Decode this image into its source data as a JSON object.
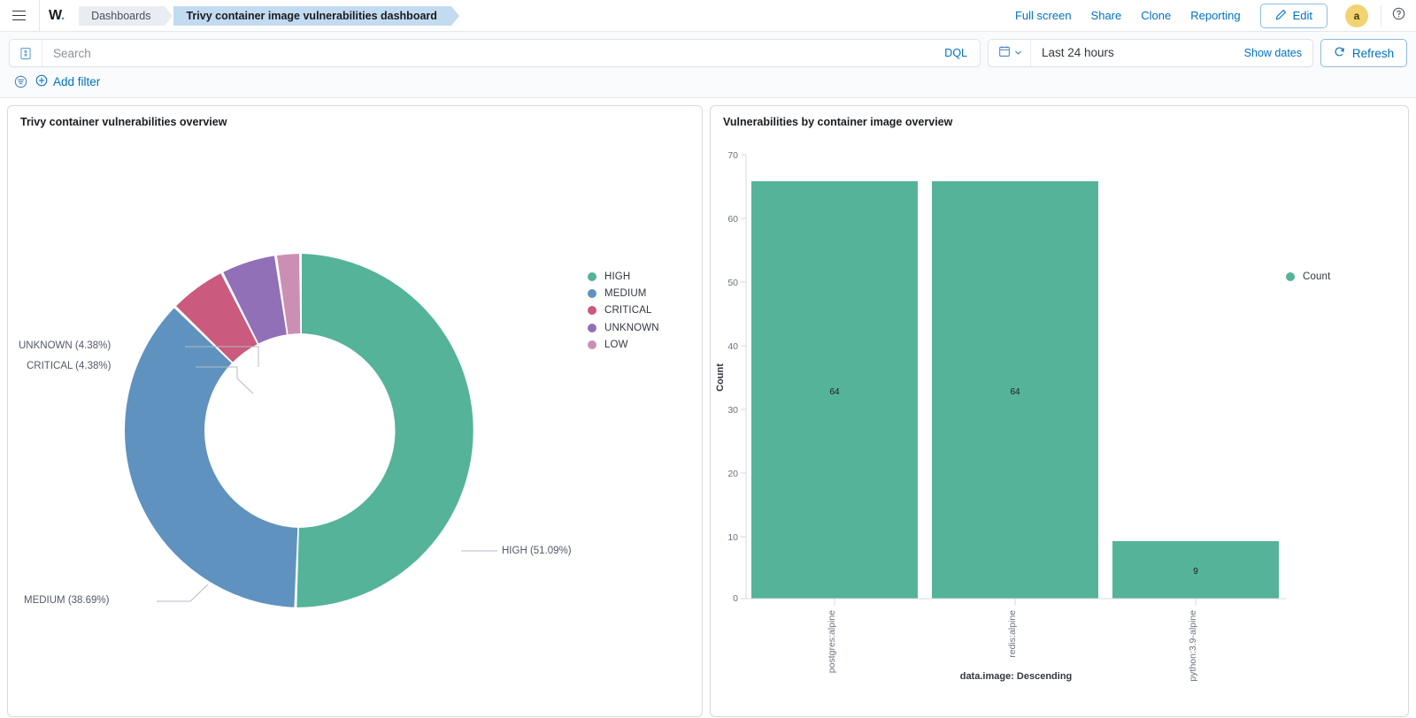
{
  "topnav": {
    "menu_icon": "hamburger-icon",
    "logo": "W",
    "logo_dot": ".",
    "breadcrumbs": [
      {
        "label": "Dashboards",
        "active": false
      },
      {
        "label": "Trivy container image vulnerabilities dashboard",
        "active": true
      }
    ],
    "links": [
      "Full screen",
      "Share",
      "Clone",
      "Reporting"
    ],
    "edit_label": "Edit",
    "edit_icon": "pencil-icon",
    "avatar_initial": "a",
    "help_icon": "question-circle-icon"
  },
  "querybar": {
    "saved_query_icon": "saved-query-icon",
    "search_placeholder": "Search",
    "search_value": "",
    "language": "DQL",
    "calendar_icon": "calendar-icon",
    "chevron_icon": "chevron-down-icon",
    "date_range": "Last 24 hours",
    "show_dates": "Show dates",
    "refresh_label": "Refresh",
    "refresh_icon": "refresh-icon",
    "filter_toggle_icon": "filter-icon",
    "add_filter_icon": "plus-circle-icon",
    "add_filter_label": "Add filter"
  },
  "panels": {
    "left": {
      "title": "Trivy container vulnerabilities overview"
    },
    "right": {
      "title": "Vulnerabilities by container image overview"
    }
  },
  "colors": {
    "high": "#54b399",
    "medium": "#6092c0",
    "critical": "#ca5a7e",
    "unknown": "#9170b8",
    "low": "#cc8fb4",
    "count": "#54b399",
    "accent_link": "#0071c2",
    "avatar_bg": "#f3d371"
  },
  "chart_data": [
    {
      "type": "pie",
      "variant": "donut",
      "title": "Trivy container vulnerabilities overview",
      "legend_position": "right",
      "labels": [
        "HIGH",
        "MEDIUM",
        "CRITICAL",
        "UNKNOWN",
        "LOW"
      ],
      "values": [
        51.09,
        38.69,
        4.38,
        4.38,
        1.46
      ],
      "unit": "%",
      "colors": [
        "#54b399",
        "#6092c0",
        "#ca5a7e",
        "#9170b8",
        "#cc8fb4"
      ],
      "slice_labels": [
        "HIGH (51.09%)",
        "MEDIUM (38.69%)",
        "CRITICAL (4.38%)",
        "UNKNOWN (4.38%)"
      ],
      "legend_entries": [
        "HIGH",
        "MEDIUM",
        "CRITICAL",
        "UNKNOWN",
        "LOW"
      ]
    },
    {
      "type": "bar",
      "title": "Vulnerabilities by container image overview",
      "categories": [
        "postgres:alpine",
        "redis:alpine",
        "python:3.9-alpine"
      ],
      "values": [
        64,
        64,
        9
      ],
      "bar_labels": [
        "64",
        "64",
        "9"
      ],
      "series_name": "Count",
      "xlabel": "data.image: Descending",
      "ylabel": "Count",
      "ylim": [
        0,
        70
      ],
      "yticks": [
        "0",
        "10",
        "20",
        "30",
        "40",
        "50",
        "60",
        "70"
      ],
      "grid": false,
      "legend_position": "right",
      "color": "#54b399"
    }
  ]
}
